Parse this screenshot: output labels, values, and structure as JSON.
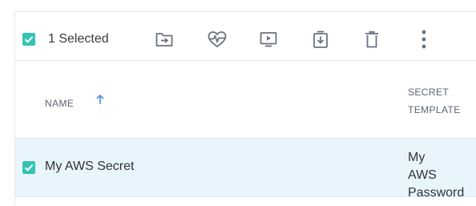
{
  "toolbar": {
    "selected_count_label": "1 Selected",
    "actions": [
      {
        "icon": "move-to-folder-icon"
      },
      {
        "icon": "heartbeat-icon"
      },
      {
        "icon": "launch-icon"
      },
      {
        "icon": "checkout-download-icon"
      },
      {
        "icon": "trash-icon"
      },
      {
        "icon": "more-vertical-icon"
      }
    ]
  },
  "table": {
    "columns": [
      {
        "label": "NAME",
        "sort": "ascending"
      },
      {
        "label": "SECRET TEMPLATE"
      }
    ],
    "rows": [
      {
        "checked": true,
        "name": "My AWS Secret",
        "template": "My AWS Password"
      }
    ]
  },
  "colors": {
    "accent_checkbox": "#35c3b4",
    "selected_row_bg": "#e9f5fc",
    "sort_arrow": "#4a8fe0",
    "icon_gray": "#6b7280"
  }
}
